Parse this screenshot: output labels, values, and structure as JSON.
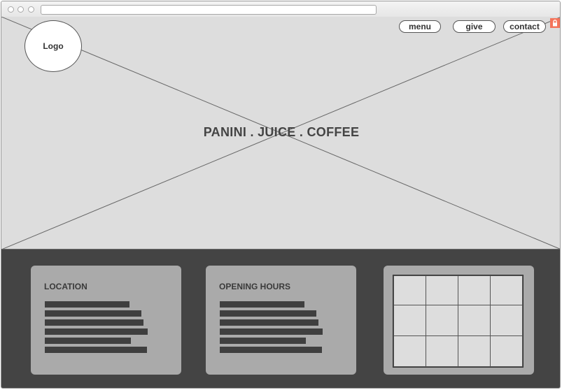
{
  "header": {
    "logo": "Logo",
    "nav": [
      {
        "label": "menu"
      },
      {
        "label": "give"
      },
      {
        "label": "contact"
      }
    ]
  },
  "hero": {
    "headline": "PANINI . JUICE . COFFEE"
  },
  "info": {
    "location_title": "LOCATION",
    "hours_title": "OPENING HOURS"
  },
  "colors": {
    "hero_bg": "#dddddd",
    "footer_bg": "#444444",
    "card_bg": "#aaaaaa",
    "lock_badge": "#f4745b"
  },
  "icons": [
    "lock-icon",
    "image-placeholder-icon"
  ]
}
